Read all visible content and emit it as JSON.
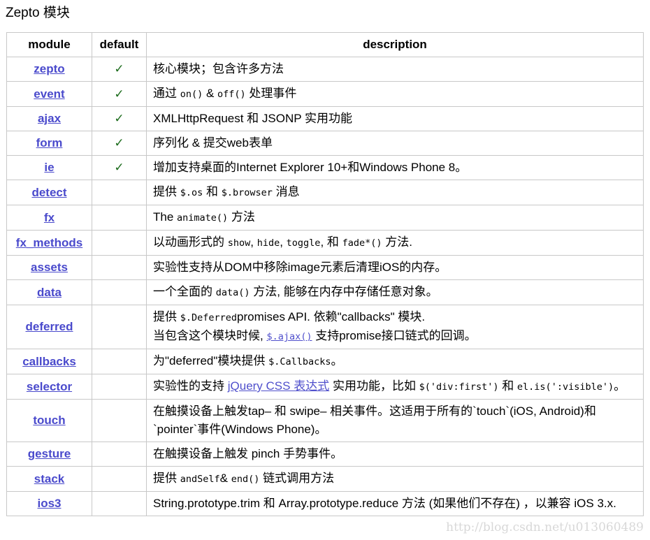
{
  "page": {
    "title": "Zepto 模块"
  },
  "table": {
    "headers": {
      "module": "module",
      "default": "default",
      "description": "description"
    },
    "rows": [
      {
        "module": "zepto",
        "default": "✓",
        "desc": [
          {
            "t": "text",
            "v": "核心模块；包含许多方法"
          }
        ]
      },
      {
        "module": "event",
        "default": "✓",
        "desc": [
          {
            "t": "text",
            "v": "通过 "
          },
          {
            "t": "code",
            "v": "on()"
          },
          {
            "t": "text",
            "v": " & "
          },
          {
            "t": "code",
            "v": "off()"
          },
          {
            "t": "text",
            "v": " 处理事件"
          }
        ]
      },
      {
        "module": "ajax",
        "default": "✓",
        "desc": [
          {
            "t": "text",
            "v": "XMLHttpRequest 和 JSONP 实用功能"
          }
        ]
      },
      {
        "module": "form",
        "default": "✓",
        "desc": [
          {
            "t": "text",
            "v": "序列化 & 提交web表单"
          }
        ]
      },
      {
        "module": "ie",
        "default": "✓",
        "desc": [
          {
            "t": "text",
            "v": "增加支持桌面的Internet Explorer 10+和Windows Phone 8。"
          }
        ]
      },
      {
        "module": "detect",
        "default": "",
        "desc": [
          {
            "t": "text",
            "v": "提供 "
          },
          {
            "t": "code",
            "v": "$.os"
          },
          {
            "t": "text",
            "v": " 和 "
          },
          {
            "t": "code",
            "v": "$.browser"
          },
          {
            "t": "text",
            "v": " 消息"
          }
        ]
      },
      {
        "module": "fx",
        "default": "",
        "desc": [
          {
            "t": "text",
            "v": "The "
          },
          {
            "t": "code",
            "v": "animate()"
          },
          {
            "t": "text",
            "v": " 方法"
          }
        ]
      },
      {
        "module": "fx_methods",
        "default": "",
        "desc": [
          {
            "t": "text",
            "v": "以动画形式的 "
          },
          {
            "t": "code",
            "v": "show"
          },
          {
            "t": "text",
            "v": ", "
          },
          {
            "t": "code",
            "v": "hide"
          },
          {
            "t": "text",
            "v": ", "
          },
          {
            "t": "code",
            "v": "toggle"
          },
          {
            "t": "text",
            "v": ", 和 "
          },
          {
            "t": "code",
            "v": "fade*()"
          },
          {
            "t": "text",
            "v": " 方法."
          }
        ]
      },
      {
        "module": "assets",
        "default": "",
        "desc": [
          {
            "t": "text",
            "v": "实验性支持从DOM中移除image元素后清理iOS的内存。"
          }
        ]
      },
      {
        "module": "data",
        "default": "",
        "desc": [
          {
            "t": "text",
            "v": "一个全面的 "
          },
          {
            "t": "code",
            "v": "data()"
          },
          {
            "t": "text",
            "v": " 方法, 能够在内存中存储任意对象。"
          }
        ]
      },
      {
        "module": "deferred",
        "default": "",
        "desc": [
          {
            "t": "text",
            "v": "提供 "
          },
          {
            "t": "code",
            "v": "$.Deferred"
          },
          {
            "t": "text",
            "v": "promises API. 依赖\"callbacks\" 模块."
          },
          {
            "t": "br"
          },
          {
            "t": "text",
            "v": "当包含这个模块时候, "
          },
          {
            "t": "codelink",
            "v": "$.ajax()"
          },
          {
            "t": "text",
            "v": " 支持promise接口链式的回调。"
          }
        ]
      },
      {
        "module": "callbacks",
        "default": "",
        "desc": [
          {
            "t": "text",
            "v": "为\"deferred\"模块提供 "
          },
          {
            "t": "code",
            "v": "$.Callbacks"
          },
          {
            "t": "text",
            "v": "。"
          }
        ]
      },
      {
        "module": "selector",
        "default": "",
        "desc": [
          {
            "t": "text",
            "v": "实验性的支持 "
          },
          {
            "t": "link",
            "v": "jQuery CSS 表达式"
          },
          {
            "t": "text",
            "v": " 实用功能，比如 "
          },
          {
            "t": "code",
            "v": "$('div:first')"
          },
          {
            "t": "text",
            "v": " 和 "
          },
          {
            "t": "code",
            "v": "el.is(':visible')"
          },
          {
            "t": "text",
            "v": "。"
          }
        ]
      },
      {
        "module": "touch",
        "default": "",
        "desc": [
          {
            "t": "text",
            "v": "在触摸设备上触发tap– 和 swipe– 相关事件。这适用于所有的`touch`(iOS, Android)和 `pointer`事件(Windows Phone)。"
          }
        ]
      },
      {
        "module": "gesture",
        "default": "",
        "desc": [
          {
            "t": "text",
            "v": "在触摸设备上触发 pinch 手势事件。"
          }
        ]
      },
      {
        "module": "stack",
        "default": "",
        "desc": [
          {
            "t": "text",
            "v": "提供 "
          },
          {
            "t": "code",
            "v": "andSelf"
          },
          {
            "t": "text",
            "v": "& "
          },
          {
            "t": "code",
            "v": "end()"
          },
          {
            "t": "text",
            "v": " 链式调用方法"
          }
        ]
      },
      {
        "module": "ios3",
        "default": "",
        "desc": [
          {
            "t": "text",
            "v": "String.prototype.trim 和 Array.prototype.reduce 方法 (如果他们不存在) ，以兼容 iOS 3.x."
          }
        ]
      }
    ]
  },
  "watermark": "http://blog.csdn.net/u013060489",
  "colors": {
    "module_link": "#4a4acc",
    "check": "#1b6b1b",
    "border": "#c8c8c8",
    "watermark": "#d8d8d8"
  }
}
